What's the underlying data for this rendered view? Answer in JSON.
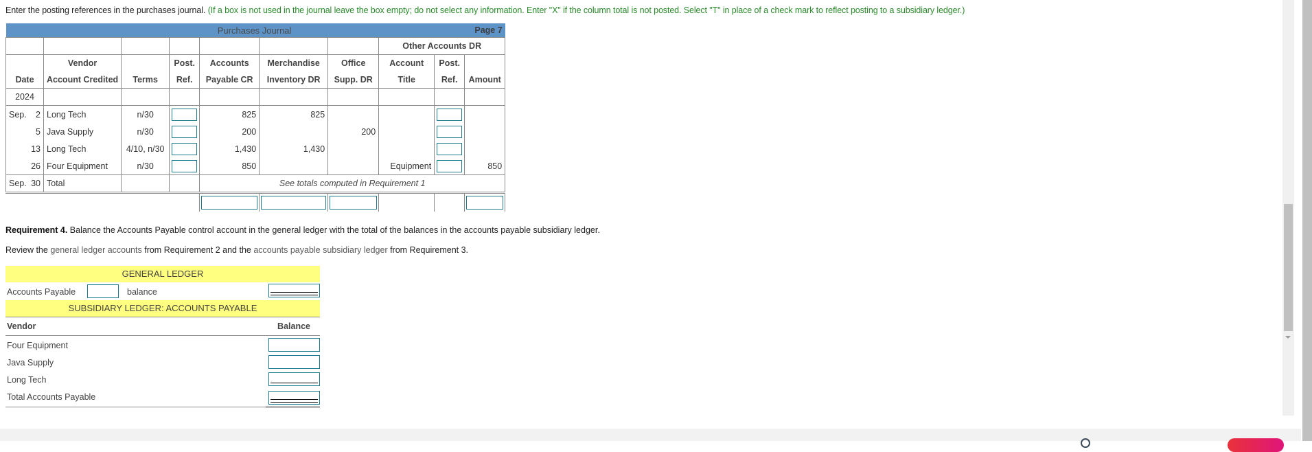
{
  "instructions": {
    "main": "Enter the posting references in the purchases journal.",
    "note": "(If a box is not used in the journal leave the box empty; do not select any information. Enter \"X\" if the column total is not posted. Select \"T\" in place of a check mark to reflect posting to a subsidiary ledger.)"
  },
  "journal": {
    "title": "Purchases Journal",
    "page": "Page 7",
    "other_group": "Other Accounts DR",
    "headers": {
      "date": "Date",
      "vendor_l1": "Vendor",
      "vendor_l2": "Account Credited",
      "terms": "Terms",
      "postref_l1": "Post.",
      "postref_l2": "Ref.",
      "ap_l1": "Accounts",
      "ap_l2": "Payable CR",
      "mi_l1": "Merchandise",
      "mi_l2": "Inventory DR",
      "os_l1": "Office",
      "os_l2": "Supp. DR",
      "acct_l1": "Account",
      "acct_l2": "Title",
      "opr_l1": "Post.",
      "opr_l2": "Ref.",
      "amount": "Amount"
    },
    "year": "2024",
    "rows": [
      {
        "month": "Sep.",
        "day": "2",
        "vendor": "Long Tech",
        "terms": "n/30",
        "ap": "825",
        "mi": "825",
        "os": "",
        "acct": "",
        "amount": ""
      },
      {
        "month": "",
        "day": "5",
        "vendor": "Java Supply",
        "terms": "n/30",
        "ap": "200",
        "mi": "",
        "os": "200",
        "acct": "",
        "amount": ""
      },
      {
        "month": "",
        "day": "13",
        "vendor": "Long Tech",
        "terms": "4/10, n/30",
        "ap": "1,430",
        "mi": "1,430",
        "os": "",
        "acct": "",
        "amount": ""
      },
      {
        "month": "",
        "day": "26",
        "vendor": "Four Equipment",
        "terms": "n/30",
        "ap": "850",
        "mi": "",
        "os": "",
        "acct": "Equipment",
        "amount": "850"
      }
    ],
    "total_row": {
      "month": "Sep.",
      "day": "30",
      "label": "Total",
      "note": "See totals computed in Requirement 1"
    }
  },
  "requirement4": {
    "bold": "Requirement 4.",
    "text": " Balance the Accounts Payable control account in the general ledger with the total of the balances in the accounts payable subsidiary ledger.",
    "review_1": "Review the ",
    "review_link1": "general ledger accounts",
    "review_2": " from Requirement 2 and the ",
    "review_link2": "accounts payable subsidiary ledger",
    "review_3": " from Requirement 3."
  },
  "general_ledger": {
    "title": "GENERAL LEDGER",
    "account": "Accounts Payable",
    "balance_word": "balance"
  },
  "subsidiary_ledger": {
    "title": "SUBSIDIARY LEDGER: ACCOUNTS PAYABLE",
    "col_vendor": "Vendor",
    "col_balance": "Balance",
    "vendors": [
      "Four Equipment",
      "Java Supply",
      "Long Tech"
    ],
    "total_label": "Total Accounts Payable"
  },
  "colors": {
    "journal_header": "#5e93c8",
    "ledger_header": "#ffff80",
    "input_border": "#1b7a8c",
    "note_green": "#2a8a2a"
  }
}
